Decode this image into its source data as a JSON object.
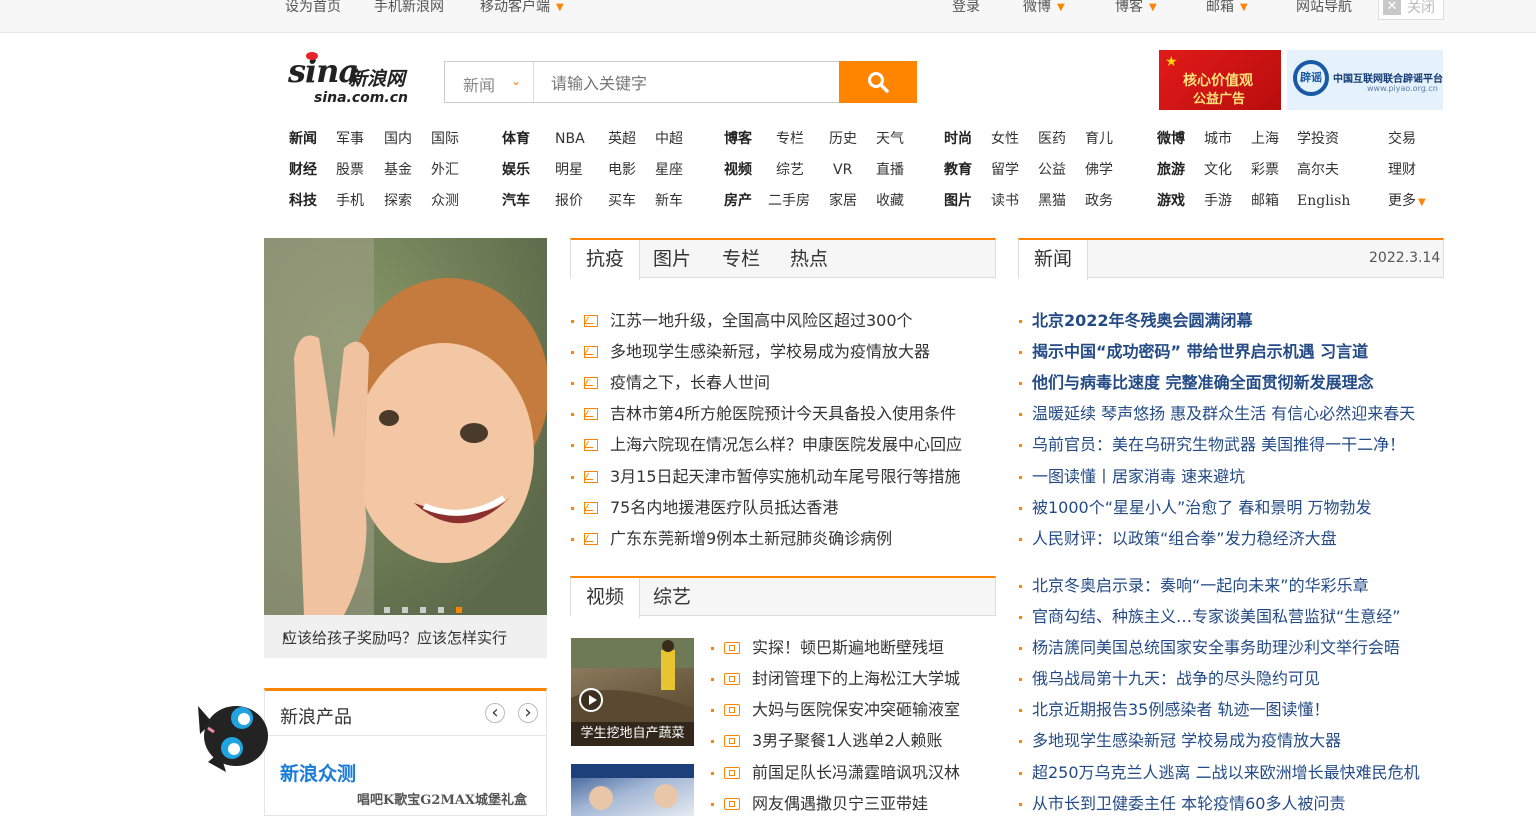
{
  "topbar": {
    "left": [
      "设为首页",
      "手机新浪网",
      "移动客户端"
    ],
    "right": [
      "登录",
      "微博",
      "博客",
      "邮箱",
      "网站导航"
    ],
    "close": "关闭"
  },
  "logo": {
    "text": "sina",
    "cn": "新浪网",
    "domain": "sina.com.cn"
  },
  "search": {
    "category": "新闻",
    "placeholder": "请输入关键字"
  },
  "ads": {
    "a1_line1": "核心价值观",
    "a1_line2": "公益广告",
    "a2_badge": "辟谣",
    "a2_title": "中国互联网联合辟谣平台",
    "a2_url": "www.piyao.org.cn"
  },
  "nav": {
    "c1": [
      [
        "新闻",
        "军事",
        "国内",
        "国际"
      ],
      [
        "财经",
        "股票",
        "基金",
        "外汇"
      ],
      [
        "科技",
        "手机",
        "探索",
        "众测"
      ]
    ],
    "c2": [
      [
        "体育",
        "NBA",
        "英超",
        "中超"
      ],
      [
        "娱乐",
        "明星",
        "电影",
        "星座"
      ],
      [
        "汽车",
        "报价",
        "买车",
        "新车"
      ]
    ],
    "c3": [
      [
        "博客",
        "专栏",
        "历史",
        "天气"
      ],
      [
        "视频",
        "综艺",
        "VR",
        "直播"
      ],
      [
        "房产",
        "二手房",
        "家居",
        "收藏"
      ]
    ],
    "c4": [
      [
        "时尚",
        "女性",
        "医药",
        "育儿"
      ],
      [
        "教育",
        "留学",
        "公益",
        "佛学"
      ],
      [
        "图片",
        "读书",
        "黑猫",
        "政务"
      ]
    ],
    "c5": [
      [
        "微博",
        "城市",
        "上海",
        "学投资"
      ],
      [
        "旅游",
        "文化",
        "彩票",
        "高尔夫"
      ],
      [
        "游戏",
        "手游",
        "邮箱",
        "English"
      ]
    ],
    "c6": [
      "交易",
      "理财",
      "更多"
    ]
  },
  "slide": {
    "caption": "应该给孩子奖励吗？应该怎样实行"
  },
  "epidemic": {
    "tabs": [
      "抗疫",
      "图片",
      "专栏",
      "热点"
    ],
    "items": [
      "江苏一地升级，全国高中风险区超过300个",
      "多地现学生感染新冠，学校易成为疫情放大器",
      "疫情之下，长春人世间",
      "吉林市第4所方舱医院预计今天具备投入使用条件",
      "上海六院现在情况怎么样？申康医院发展中心回应",
      "3月15日起天津市暂停实施机动车尾号限行等措施",
      "75名内地援港医疗队员抵达香港",
      "广东东莞新增9例本土新冠肺炎确诊病例"
    ]
  },
  "video": {
    "tabs": [
      "视频",
      "综艺"
    ],
    "thumb1_caption": "学生挖地自产蔬菜",
    "items": [
      "实探！顿巴斯遍地断壁残垣",
      "封闭管理下的上海松江大学城",
      "大妈与医院保安冲突砸输液室",
      "3男子聚餐1人逃单2人赖账",
      "前国足队长冯潇霆暗讽巩汉林",
      "网友偶遇撒贝宁三亚带娃"
    ]
  },
  "news": {
    "tab": "新闻",
    "date": "2022.3.14",
    "bold_items": [
      "北京2022年冬残奥会圆满闭幕",
      "揭示中国“成功密码” 带给世界启示机遇 习言道",
      "他们与病毒比速度 完整准确全面贯彻新发展理念"
    ],
    "items": [
      "温暖延续 琴声悠扬 惠及群众生活 有信心必然迎来春天",
      "乌前官员：美在乌研究生物武器 美国推得一干二净！",
      "一图读懂丨居家消毒 速来避坑",
      "被1000个“星星小人”治愈了 春和景明 万物勃发",
      "人民财评：以政策“组合拳”发力稳经济大盘"
    ],
    "items2": [
      "北京冬奥启示录：奏响“一起向未来”的华彩乐章",
      "官商勾结、种族主义…专家谈美国私营监狱“生意经”",
      "杨洁篪同美国总统国家安全事务助理沙利文举行会晤",
      "俄乌战局第十九天：战争的尽头隐约可见",
      "北京近期报告35例感染者 轨迹一图读懂！",
      "多地现学生感染新冠 学校易成为疫情放大器",
      "超250万乌克兰人逃离 二战以来欧洲增长最快难民危机",
      "从市长到卫健委主任 本轮疫情60多人被问责"
    ]
  },
  "products": {
    "title": "新浪产品",
    "name": "新浪众测",
    "sub": "唱吧K歌宝G2MAX城堡礼盒"
  }
}
